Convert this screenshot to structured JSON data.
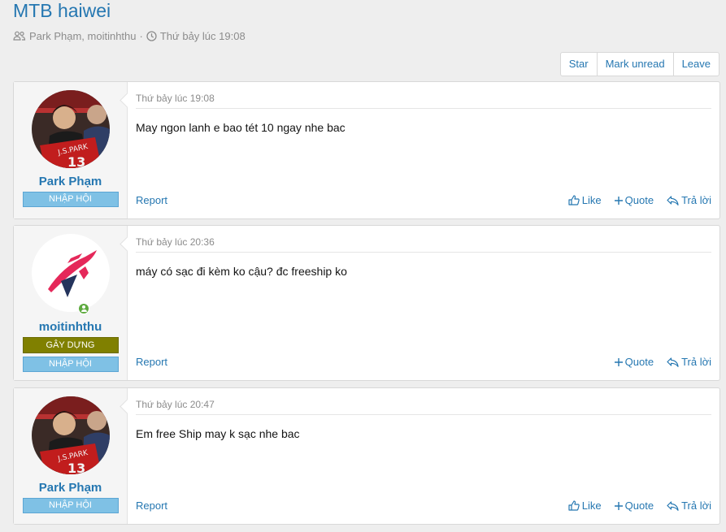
{
  "thread": {
    "title": "MTB haiwei",
    "participants": "Park Phạm, moitinhthu",
    "separator": "·",
    "started": "Thứ bảy lúc 19:08"
  },
  "toolbar": {
    "star_label": "Star",
    "mark_unread_label": "Mark unread",
    "leave_label": "Leave"
  },
  "posts": [
    {
      "username": "Park Phạm",
      "banners": [
        "NHẬP HỘI"
      ],
      "date": "Thứ bảy lúc 19:08",
      "message": "May ngon lanh e bao tét 10 ngay nhe bac",
      "report": "Report",
      "like": "Like",
      "quote": "Quote",
      "reply": "Trả lời"
    },
    {
      "username": "moitinhthu",
      "banners": [
        "GÂY DỰNG",
        "NHẬP HỘI"
      ],
      "date": "Thứ bảy lúc 20:36",
      "message": "máy có sạc đi kèm ko cậu? đc freeship ko",
      "report": "Report",
      "quote": "Quote",
      "reply": "Trả lời"
    },
    {
      "username": "Park Phạm",
      "banners": [
        "NHẬP HỘI"
      ],
      "date": "Thứ bảy lúc 20:47",
      "message": "Em free Ship may k sạc nhe bac",
      "report": "Report",
      "like": "Like",
      "quote": "Quote",
      "reply": "Trả lời"
    }
  ],
  "colors": {
    "link": "#2577b1",
    "banner_member": "#7fc1e5",
    "banner_builder": "#808000",
    "online": "#5eaa3f"
  },
  "icons": [
    "users-icon",
    "clock-icon",
    "thumbs-up-icon",
    "plus-icon",
    "reply-icon",
    "online-icon"
  ]
}
